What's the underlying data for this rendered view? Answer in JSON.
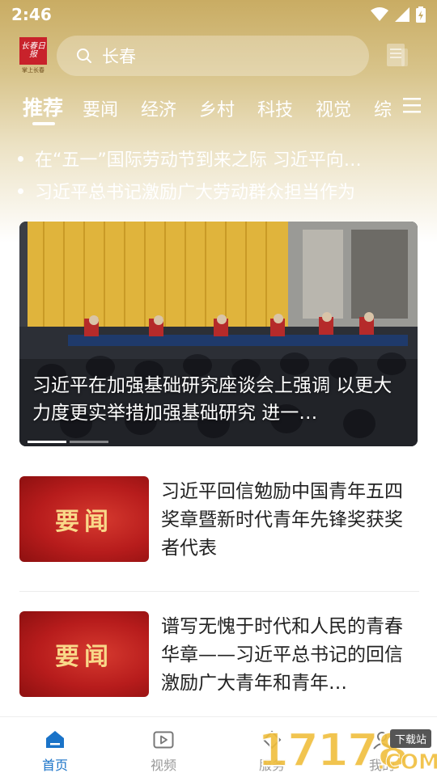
{
  "status_bar": {
    "time": "2:46"
  },
  "header": {
    "logo_text": "长春日报",
    "logo_sub": "掌上长春",
    "search_text": "长春"
  },
  "tabs": [
    {
      "label": "推荐",
      "active": true
    },
    {
      "label": "要闻"
    },
    {
      "label": "经济"
    },
    {
      "label": "乡村"
    },
    {
      "label": "科技"
    },
    {
      "label": "视觉"
    },
    {
      "label": "综"
    }
  ],
  "headlines": [
    "在“五一”国际劳动节到来之际 习近平向…",
    "习近平总书记激励广大劳动群众担当作为"
  ],
  "banner": {
    "caption": "习近平在加强基础研究座谈会上强调 以更大力度更实举措加强基础研究 进一…",
    "slide_count": 2,
    "active_slide": 0
  },
  "news": [
    {
      "thumb_label": "要闻",
      "title": "习近平回信勉励中国青年五四奖章暨新时代青年先锋奖获奖者代表"
    },
    {
      "thumb_label": "要闻",
      "title": "谱写无愧于时代和人民的青春华章——习近平总书记的回信激励广大青年和青年…"
    }
  ],
  "bottom_nav": [
    {
      "label": "首页",
      "icon": "home-icon",
      "active": true
    },
    {
      "label": "视频",
      "icon": "video-icon"
    },
    {
      "label": "服务",
      "icon": "service-icon"
    },
    {
      "label": "我的",
      "icon": "profile-icon"
    }
  ],
  "watermark": {
    "number": "17178",
    "tag": "下载站",
    "domain": ".COM"
  },
  "colors": {
    "accent": "#1a73c8",
    "header_gold": "#c9ac63",
    "thumb_red": "#b71c1c"
  }
}
